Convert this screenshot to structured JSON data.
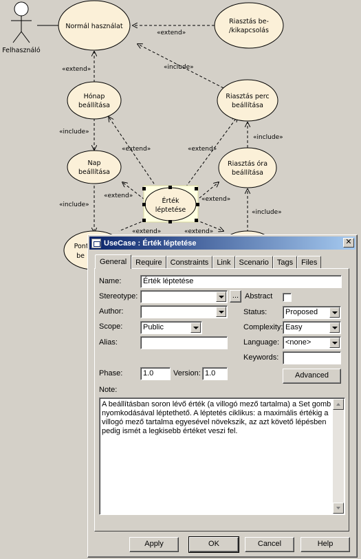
{
  "diagram": {
    "actor": "Felhasználó",
    "use_cases": {
      "normal": "Normál használat",
      "alarm_onoff_1": "Riasztás be-",
      "alarm_onoff_2": "/kikapcsolás",
      "month_1": "Hónap",
      "month_2": "beállítása",
      "alarm_min_1": "Riasztás perc",
      "alarm_min_2": "beállítása",
      "day_1": "Nap",
      "day_2": "beállítása",
      "alarm_hour_1": "Riasztás óra",
      "alarm_hour_2": "beállítása",
      "step_1": "Érték",
      "step_2": "léptetése",
      "exact_1": "Ponto",
      "exact_2": "be"
    },
    "stereotypes": {
      "extend": "«extend»",
      "include": "«include»"
    }
  },
  "dialog": {
    "title": "UseCase : Érték léptetése",
    "tabs": [
      "General",
      "Require",
      "Constraints",
      "Link",
      "Scenario",
      "Tags",
      "Files"
    ],
    "active_tab": "General",
    "fields": {
      "name_label": "Name:",
      "name_value": "Érték léptetése",
      "stereotype_label": "Stereotype:",
      "stereotype_value": "",
      "ellipsis": "...",
      "abstract_label": "Abstract",
      "author_label": "Author:",
      "author_value": "",
      "status_label": "Status:",
      "status_value": "Proposed",
      "scope_label": "Scope:",
      "scope_value": "Public",
      "complexity_label": "Complexity:",
      "complexity_value": "Easy",
      "alias_label": "Alias:",
      "alias_value": "",
      "language_label": "Language:",
      "language_value": "<none>",
      "keywords_label": "Keywords:",
      "keywords_value": "",
      "advanced_button": "Advanced",
      "phase_label": "Phase:",
      "phase_value": "1.0",
      "version_label": "Version:",
      "version_value": "1.0",
      "note_label": "Note:",
      "note_text": "A beállításban soron lévő érték (a villogó mező tartalma) a Set gomb nyomkodásával léptethető. A léptetés ciklikus: a maximális értékig a villogó mező tartalma egyesével növekszik, az azt követő lépésben pedig ismét a legkisebb értéket veszi fel."
    },
    "buttons": {
      "apply": "Apply",
      "ok": "OK",
      "cancel": "Cancel",
      "help": "Help"
    }
  }
}
